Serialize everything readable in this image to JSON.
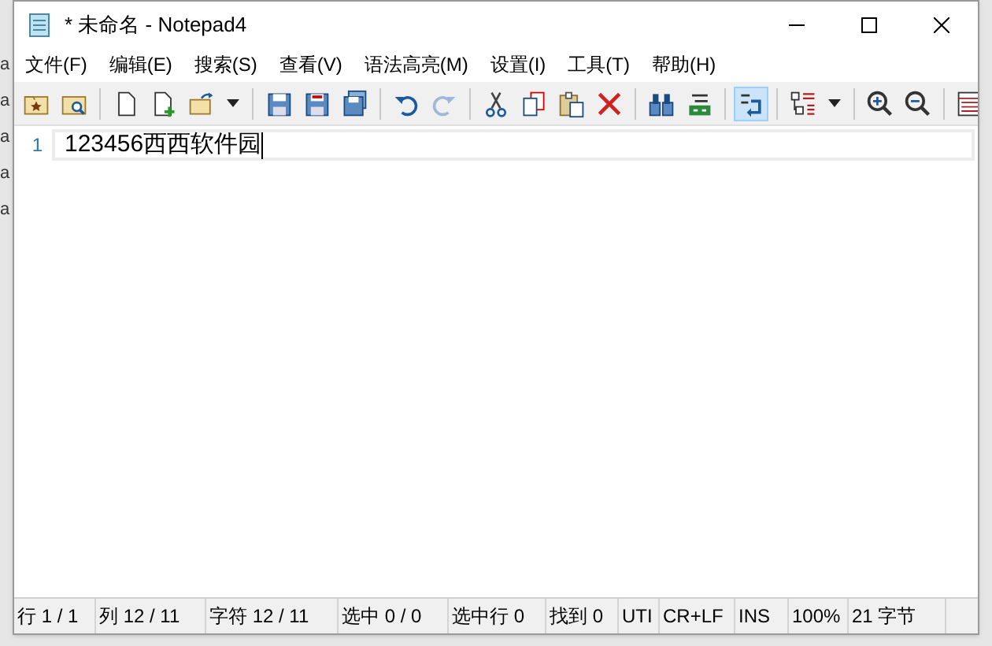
{
  "background_fragments": [
    "a",
    "a",
    "a",
    "a",
    "a"
  ],
  "window": {
    "title": "* 未命名 - Notepad4"
  },
  "menu": [
    "文件(F)",
    "编辑(E)",
    "搜索(S)",
    "查看(V)",
    "语法高亮(M)",
    "设置(I)",
    "工具(T)",
    "帮助(H)"
  ],
  "toolbar": [
    {
      "kind": "button",
      "selected": false
    },
    {
      "kind": "button",
      "selected": false
    },
    {
      "kind": "separator"
    },
    {
      "kind": "button",
      "selected": false
    },
    {
      "kind": "button",
      "selected": false
    },
    {
      "kind": "button",
      "selected": false
    },
    {
      "kind": "dropdown"
    },
    {
      "kind": "separator"
    },
    {
      "kind": "button",
      "selected": false
    },
    {
      "kind": "button",
      "selected": false
    },
    {
      "kind": "button",
      "selected": false
    },
    {
      "kind": "separator"
    },
    {
      "kind": "button",
      "selected": false
    },
    {
      "kind": "button",
      "selected": false
    },
    {
      "kind": "separator"
    },
    {
      "kind": "button",
      "selected": false
    },
    {
      "kind": "button",
      "selected": false
    },
    {
      "kind": "button",
      "selected": false
    },
    {
      "kind": "button",
      "selected": false
    },
    {
      "kind": "separator"
    },
    {
      "kind": "button",
      "selected": false
    },
    {
      "kind": "button",
      "selected": false
    },
    {
      "kind": "separator"
    },
    {
      "kind": "button",
      "selected": true
    },
    {
      "kind": "separator"
    },
    {
      "kind": "button",
      "selected": false
    },
    {
      "kind": "dropdown"
    },
    {
      "kind": "separator"
    },
    {
      "kind": "button",
      "selected": false
    },
    {
      "kind": "button",
      "selected": false
    },
    {
      "kind": "separator"
    },
    {
      "kind": "button",
      "selected": false
    }
  ],
  "editor": {
    "lines": [
      {
        "number": "1",
        "text": "123456西西软件园",
        "current": true
      }
    ]
  },
  "status_bar": [
    "行 1 / 1",
    "列 12 / 11",
    "字符 12 / 11",
    "选中 0 / 0",
    "选中行 0",
    "找到 0",
    "UTI",
    "CR+LF",
    "INS",
    "100%",
    "21 字节"
  ]
}
